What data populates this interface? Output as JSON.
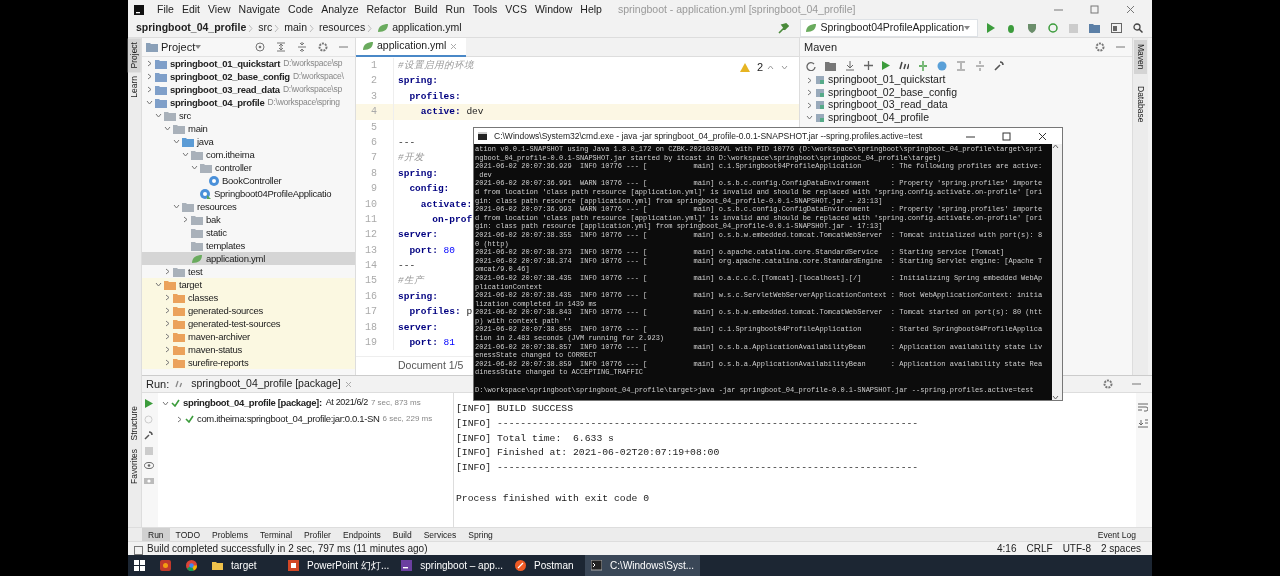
{
  "title_bar": {
    "menu": [
      "File",
      "Edit",
      "View",
      "Navigate",
      "Code",
      "Analyze",
      "Refactor",
      "Build",
      "Run",
      "Tools",
      "VCS",
      "Window",
      "Help"
    ],
    "title": "springboot - application.yml [springboot_04_profile]"
  },
  "breadcrumb": [
    {
      "label": "springboot_04_profile",
      "kind": "project"
    },
    {
      "label": "src",
      "kind": "folder"
    },
    {
      "label": "main",
      "kind": "folder"
    },
    {
      "label": "resources",
      "kind": "folder"
    },
    {
      "label": "application.yml",
      "kind": "yml"
    }
  ],
  "run_config": "Springboot04ProfileApplication",
  "left_stripe": {
    "top": [
      {
        "label": "Project",
        "selected": true
      },
      {
        "label": "Learn",
        "selected": false
      }
    ],
    "bottom": [
      {
        "label": "Structure",
        "selected": false
      },
      {
        "label": "Favorites",
        "selected": false
      }
    ]
  },
  "right_stripe": [
    {
      "label": "Maven",
      "selected": true
    },
    {
      "label": "Database",
      "selected": false
    }
  ],
  "project": {
    "title": "Project",
    "tree": [
      {
        "label": "springboot_01_quickstart",
        "path": "D:\\workspace\\sp",
        "kind": "module",
        "expanded": false,
        "selected": false
      },
      {
        "label": "springboot_02_base_config",
        "path": "D:\\workspace\\",
        "kind": "module",
        "expanded": false,
        "selected": false
      },
      {
        "label": "springboot_03_read_data",
        "path": "D:\\workspace\\sp",
        "kind": "module",
        "expanded": false,
        "selected": false
      },
      {
        "label": "springboot_04_profile",
        "path": "D:\\workspace\\spring",
        "kind": "module",
        "expanded": true,
        "selected": false,
        "children": [
          {
            "label": "src",
            "kind": "folder",
            "expanded": true,
            "selected": false,
            "children": [
              {
                "label": "main",
                "kind": "folder",
                "expanded": true,
                "selected": false,
                "children": [
                  {
                    "label": "java",
                    "kind": "source",
                    "expanded": true,
                    "selected": false,
                    "children": [
                      {
                        "label": "com.itheima",
                        "kind": "package",
                        "expanded": true,
                        "selected": false,
                        "children": [
                          {
                            "label": "controller",
                            "kind": "package",
                            "expanded": true,
                            "selected": false,
                            "children": [
                              {
                                "label": "BookController",
                                "kind": "class",
                                "selected": false
                              }
                            ]
                          },
                          {
                            "label": "Springboot04ProfileApplicatio",
                            "kind": "app-class",
                            "selected": false
                          }
                        ]
                      }
                    ]
                  },
                  {
                    "label": "resources",
                    "kind": "resources",
                    "expanded": true,
                    "selected": false,
                    "children": [
                      {
                        "label": "bak",
                        "kind": "folder",
                        "expanded": false,
                        "selected": false
                      },
                      {
                        "label": "static",
                        "kind": "folder",
                        "selected": false
                      },
                      {
                        "label": "templates",
                        "kind": "folder",
                        "selected": false
                      },
                      {
                        "label": "application.yml",
                        "kind": "yml",
                        "selected": true
                      }
                    ]
                  }
                ]
              },
              {
                "label": "test",
                "kind": "folder",
                "expanded": false,
                "selected": false
              }
            ]
          },
          {
            "label": "target",
            "kind": "build",
            "expanded": true,
            "excluded": true,
            "selected": false,
            "children": [
              {
                "label": "classes",
                "kind": "build",
                "expanded": false,
                "selected": false
              },
              {
                "label": "generated-sources",
                "kind": "build",
                "expanded": false,
                "selected": false
              },
              {
                "label": "generated-test-sources",
                "kind": "build",
                "expanded": false,
                "selected": false
              },
              {
                "label": "maven-archiver",
                "kind": "build",
                "expanded": false,
                "selected": false
              },
              {
                "label": "maven-status",
                "kind": "build",
                "expanded": false,
                "selected": false
              },
              {
                "label": "surefire-reports",
                "kind": "build",
                "expanded": false,
                "selected": false
              }
            ]
          }
        ]
      }
    ]
  },
  "editor": {
    "tab": "application.yml",
    "warnings": "2",
    "lines": [
      {
        "number": "1",
        "kind": "comment",
        "text": "#设置启用的环境",
        "current": false
      },
      {
        "number": "2",
        "kind": "pair",
        "key": "spring:",
        "current": false
      },
      {
        "number": "3",
        "kind": "pair",
        "key": "  profiles:",
        "current": false
      },
      {
        "number": "4",
        "kind": "pair",
        "key": "    active:",
        "value": " dev",
        "current": true
      },
      {
        "number": "5",
        "kind": "blank",
        "current": false
      },
      {
        "number": "6",
        "kind": "separator",
        "text": "---",
        "current": false
      },
      {
        "number": "7",
        "kind": "comment",
        "text": "#开发",
        "current": false
      },
      {
        "number": "8",
        "kind": "pair",
        "key": "spring:",
        "current": false
      },
      {
        "number": "9",
        "kind": "pair",
        "key": "  config:",
        "current": false
      },
      {
        "number": "10",
        "kind": "pair",
        "key": "    activate:",
        "current": false
      },
      {
        "number": "11",
        "kind": "pair",
        "key": "      on-prof",
        "current": false
      },
      {
        "number": "12",
        "kind": "pair",
        "key": "server:",
        "current": false
      },
      {
        "number": "13",
        "kind": "number-pair",
        "key": "  port:",
        "value": " 80",
        "current": false
      },
      {
        "number": "14",
        "kind": "separator",
        "text": "---",
        "current": false
      },
      {
        "number": "15",
        "kind": "comment",
        "text": "#生产",
        "current": false
      },
      {
        "number": "16",
        "kind": "pair",
        "key": "spring:",
        "current": false
      },
      {
        "number": "17",
        "kind": "pair",
        "key": "  profiles:",
        "value": " p",
        "current": false
      },
      {
        "number": "18",
        "kind": "pair",
        "key": "server:",
        "current": false
      },
      {
        "number": "19",
        "kind": "number-pair",
        "key": "  port:",
        "value": " 81",
        "current": false
      }
    ],
    "footer": "Document 1/5"
  },
  "maven": {
    "title": "Maven",
    "projects": [
      {
        "label": "springboot_01_quickstart",
        "expanded": false
      },
      {
        "label": "springboot_02_base_config",
        "expanded": false
      },
      {
        "label": "springboot_03_read_data",
        "expanded": false
      },
      {
        "label": "springboot_04_profile",
        "expanded": true
      }
    ]
  },
  "run": {
    "label": "Run:",
    "tab": "springboot_04_profile [package]",
    "tree": [
      {
        "label": "springboot_04_profile [package]:",
        "detail": "At 2021/6/2",
        "time": "7 sec, 873 ms",
        "expanded": true,
        "children": [
          {
            "label": "com.itheima:springboot_04_profile:jar:0.0.1-SN",
            "time": "6 sec, 229 ms",
            "expanded": false
          }
        ]
      }
    ],
    "console": [
      "[INFO] BUILD SUCCESS",
      "[INFO] ------------------------------------------------------------------------",
      "[INFO] Total time:  6.633 s",
      "[INFO] Finished at: 2021-06-02T20:07:19+08:00",
      "[INFO] ------------------------------------------------------------------------"
    ],
    "exit_message": "Process finished with exit code 0"
  },
  "tool_tabs": [
    {
      "label": "Run",
      "selected": true
    },
    {
      "label": "TODO",
      "selected": false
    },
    {
      "label": "Problems",
      "selected": false
    },
    {
      "label": "Terminal",
      "selected": false
    },
    {
      "label": "Profiler",
      "selected": false
    },
    {
      "label": "Endpoints",
      "selected": false
    },
    {
      "label": "Build",
      "selected": false
    },
    {
      "label": "Services",
      "selected": false
    },
    {
      "label": "Spring",
      "selected": false
    }
  ],
  "event_log": "Event Log",
  "status_bar": {
    "message": "Build completed successfully in 2 sec, 797 ms (11 minutes ago)",
    "items": [
      "4:16",
      "CRLF",
      "UTF-8",
      "2 spaces"
    ]
  },
  "taskbar": [
    {
      "kind": "start",
      "selected": false
    },
    {
      "kind": "app",
      "selected": false
    },
    {
      "kind": "browser",
      "selected": false
    },
    {
      "kind": "folder",
      "label": "target",
      "selected": false
    },
    {
      "kind": "slides",
      "label": "PowerPoint 幻灯...",
      "selected": false
    },
    {
      "kind": "ide",
      "label": "springboot – app...",
      "selected": false
    },
    {
      "kind": "postman",
      "label": "Postman",
      "selected": false
    },
    {
      "kind": "terminal",
      "label": "C:\\Windows\\Syst...",
      "selected": true
    }
  ],
  "cmd": {
    "title": "C:\\Windows\\System32\\cmd.exe - java  -jar springboot_04_profile-0.0.1-SNAPSHOT.jar --spring.profiles.active=test",
    "lines": [
      "ation v0.0.1-SNAPSHOT using Java 1.8.0_172 on CZBK-20210302VL with PID 10776 (D:\\workspace\\springboot\\springboot_04_profile\\target\\spri",
      "ngboot_04_profile-0.0.1-SNAPSHOT.jar started by itcast in D:\\workspace\\springboot\\springboot_04_profile\\target)",
      "2021-06-02 20:07:36.929  INFO 10776 --- [           main] c.i.Springboot04ProfileApplication       : The following profiles are active:",
      " dev",
      "2021-06-02 20:07:36.991  WARN 10776 --- [           main] o.s.b.c.config.ConfigDataEnvironment     : Property 'spring.profiles' importe",
      "d from location 'class path resource [application.yml]' is invalid and should be replaced with 'spring.config.activate.on-profile' [ori",
      "gin: class path resource [application.yml] from springboot_04_profile-0.0.1-SNAPSHOT.jar - 23:13]",
      "2021-06-02 20:07:36.993  WARN 10776 --- [           main] o.s.b.c.config.ConfigDataEnvironment     : Property 'spring.profiles' importe",
      "d from location 'class path resource [application.yml]' is invalid and should be replaced with 'spring.config.activate.on-profile' [ori",
      "gin: class path resource [application.yml] from springboot_04_profile-0.0.1-SNAPSHOT.jar - 17:13]",
      "2021-06-02 20:07:38.355  INFO 10776 --- [           main] o.s.b.w.embedded.tomcat.TomcatWebServer  : Tomcat initialized with port(s): 8",
      "0 (http)",
      "2021-06-02 20:07:38.373  INFO 10776 --- [           main] o.apache.catalina.core.StandardService   : Starting service [Tomcat]",
      "2021-06-02 20:07:38.374  INFO 10776 --- [           main] org.apache.catalina.core.StandardEngine  : Starting Servlet engine: [Apache T",
      "omcat/9.0.46]",
      "2021-06-02 20:07:38.435  INFO 10776 --- [           main] o.a.c.c.C.[Tomcat].[localhost].[/]       : Initializing Spring embedded WebAp",
      "plicationContext",
      "2021-06-02 20:07:38.435  INFO 10776 --- [           main] w.s.c.ServletWebServerApplicationContext : Root WebApplicationContext: initia",
      "lization completed in 1439 ms",
      "2021-06-02 20:07:38.843  INFO 10776 --- [           main] o.s.b.w.embedded.tomcat.TomcatWebServer  : Tomcat started on port(s): 80 (htt",
      "p) with context path ''",
      "2021-06-02 20:07:38.855  INFO 10776 --- [           main] c.i.Springboot04ProfileApplication       : Started Springboot04ProfileApplica",
      "tion in 2.483 seconds (JVM running for 2.923)",
      "2021-06-02 20:07:38.857  INFO 10776 --- [           main] o.s.b.a.ApplicationAvailabilityBean      : Application availability state Liv",
      "enessState changed to CORRECT",
      "2021-06-02 20:07:38.859  INFO 10776 --- [           main] o.s.b.a.ApplicationAvailabilityBean      : Application availability state Rea",
      "dinessState changed to ACCEPTING_TRAFFIC"
    ],
    "prompt": "D:\\workspace\\springboot\\springboot_04_profile\\target>java -jar springboot_04_profile-0.0.1-SNAPSHOT.jar --spring.profiles.active=test"
  }
}
